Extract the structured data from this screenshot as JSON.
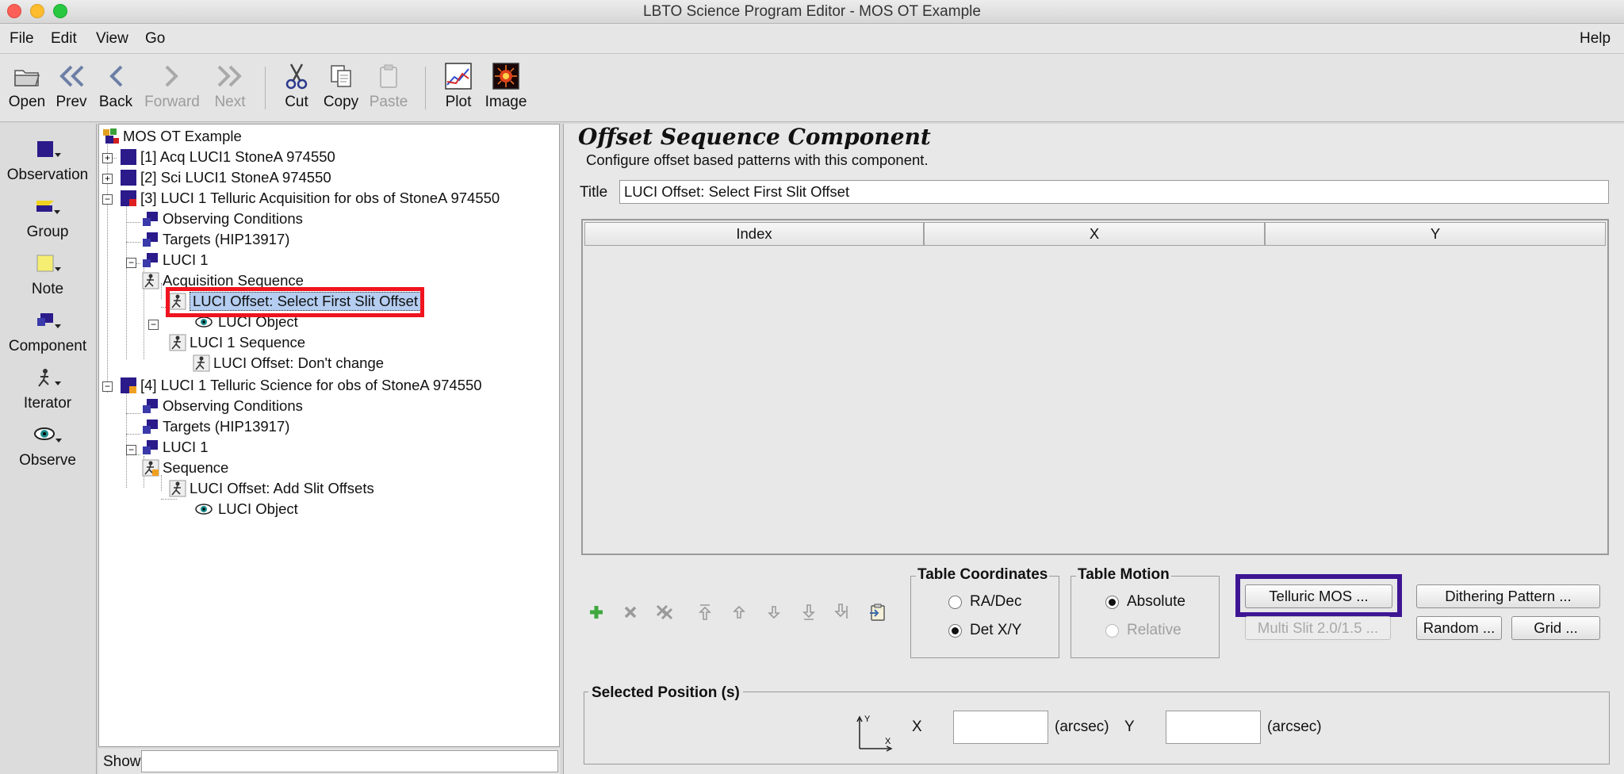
{
  "window": {
    "title": "LBTO Science Program Editor - MOS OT Example"
  },
  "menu": {
    "file": "File",
    "edit": "Edit",
    "view": "View",
    "go": "Go",
    "help": "Help"
  },
  "toolbar": {
    "open": "Open",
    "prev": "Prev",
    "back": "Back",
    "forward": "Forward",
    "next": "Next",
    "cut": "Cut",
    "copy": "Copy",
    "paste": "Paste",
    "plot": "Plot",
    "image": "Image"
  },
  "palette": {
    "observation": "Observation",
    "group": "Group",
    "note": "Note",
    "component": "Component",
    "iterator": "Iterator",
    "observe": "Observe"
  },
  "tree": {
    "root": "MOS OT Example",
    "items": [
      "[1] Acq LUCI1 StoneA 974550",
      "[2] Sci LUCI1 StoneA 974550",
      "[3] LUCI 1 Telluric Acquisition for obs of StoneA 974550",
      "Observing Conditions",
      "Targets (HIP13917)",
      "LUCI 1",
      "Acquisition Sequence",
      "LUCI Offset: Select First Slit Offset",
      "LUCI Object",
      "LUCI 1 Sequence",
      "LUCI Offset: Don't change",
      "[4] LUCI 1 Telluric Science for obs of StoneA 974550",
      "Observing Conditions",
      "Targets (HIP13917)",
      "LUCI 1",
      "Sequence",
      "LUCI Offset: Add Slit Offsets",
      "LUCI Object"
    ]
  },
  "show": {
    "label": "Show",
    "value": ""
  },
  "component": {
    "heading": "Offset Sequence Component",
    "description": "Configure offset based patterns with this component.",
    "title_label": "Title",
    "title_value": "LUCI Offset: Select First Slit Offset"
  },
  "table": {
    "columns": [
      "Index",
      "X",
      "Y"
    ]
  },
  "table_coordinates": {
    "title": "Table Coordinates",
    "ra_dec": "RA/Dec",
    "det_xy": "Det X/Y",
    "selected": "Det X/Y"
  },
  "table_motion": {
    "title": "Table Motion",
    "absolute": "Absolute",
    "relative": "Relative",
    "selected": "Absolute"
  },
  "buttons": {
    "telluric_mos": "Telluric MOS ...",
    "multi_slit": "Multi Slit 2.0/1.5 ...",
    "dithering": "Dithering Pattern ...",
    "random": "Random ...",
    "grid": "Grid ..."
  },
  "selected_position": {
    "title": "Selected Position (s)",
    "x_label": "X",
    "y_label": "Y",
    "x_value": "",
    "y_value": "",
    "x_unit": "(arcsec)",
    "y_unit": "(arcsec)",
    "axis_y": "Y",
    "axis_x": "X"
  },
  "colors": {
    "selection": "#b4cdf0",
    "red_highlight": "#f0141e",
    "purple_highlight": "#3e1694",
    "icon_blue": "#2a1a8a"
  }
}
